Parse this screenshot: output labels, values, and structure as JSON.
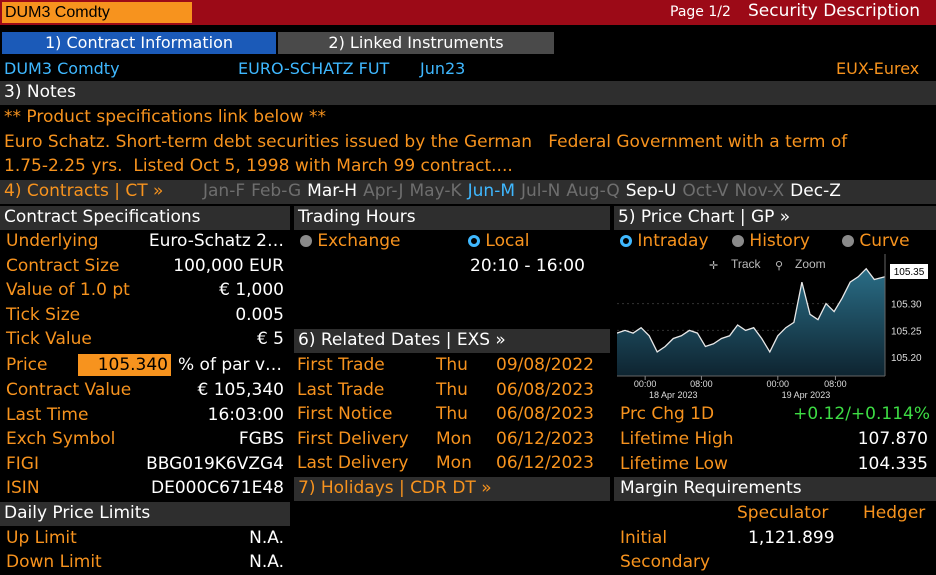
{
  "header": {
    "ticker": "DUM3 Comdty",
    "page": "Page 1/2",
    "title": "Security Description"
  },
  "tabs": [
    {
      "label": "1) Contract Information"
    },
    {
      "label": "2) Linked Instruments"
    }
  ],
  "security": {
    "ticker": "DUM3 Comdty",
    "name": "EURO-SCHATZ FUT",
    "month": "Jun23",
    "exchange": "EUX-Eurex"
  },
  "notes": {
    "title": "3) Notes",
    "link_line": "** Product specifications link below **",
    "desc1": "Euro Schatz. Short-term debt securities issued by the German   Federal Government with a term of",
    "desc2": "1.75-2.25 yrs.  Listed Oct 5, 1998 with March 99 contract...."
  },
  "contracts": {
    "label": "4) Contracts | CT »",
    "months": [
      "Jan-F",
      "Feb-G",
      "Mar-H",
      "Apr-J",
      "May-K",
      "Jun-M",
      "Jul-N",
      "Aug-Q",
      "Sep-U",
      "Oct-V",
      "Nov-X",
      "Dec-Z"
    ],
    "colors": [
      "#6e6e6e",
      "#6e6e6e",
      "#ffffff",
      "#6e6e6e",
      "#6e6e6e",
      "#3fb8ff",
      "#6e6e6e",
      "#6e6e6e",
      "#ffffff",
      "#6e6e6e",
      "#6e6e6e",
      "#ffffff"
    ]
  },
  "specs": {
    "title": "Contract Specifications",
    "rows": [
      {
        "label": "Underlying",
        "value": "Euro-Schatz 2…"
      },
      {
        "label": "Contract Size",
        "value": "100,000 EUR"
      },
      {
        "label": "Value of 1.0 pt",
        "value": "€ 1,000"
      },
      {
        "label": "Tick Size",
        "value": "0.005"
      },
      {
        "label": "Tick Value",
        "value": "€ 5"
      }
    ],
    "price_label": "Price",
    "price_value": "105.340",
    "price_unit": "% of par v…",
    "rows2": [
      {
        "label": "Contract Value",
        "value": "€ 105,340"
      },
      {
        "label": "Last Time",
        "value": "16:03:00"
      },
      {
        "label": "Exch Symbol",
        "value": "FGBS"
      },
      {
        "label": "FIGI",
        "value": "BBG019K6VZG4"
      },
      {
        "label": "ISIN",
        "value": "DE000C671E48"
      }
    ]
  },
  "limits": {
    "title": "Daily Price Limits",
    "up_label": "Up Limit",
    "up_value": "N.A.",
    "down_label": "Down Limit",
    "down_value": "N.A."
  },
  "hours": {
    "title": "Trading Hours",
    "exchange_label": "Exchange",
    "local_label": "Local",
    "time_range": "20:10 - 16:00"
  },
  "dates": {
    "title": "6) Related Dates | EXS »",
    "rows": [
      {
        "label": "First Trade",
        "day": "Thu",
        "date": "09/08/2022"
      },
      {
        "label": "Last Trade",
        "day": "Thu",
        "date": "06/08/2023"
      },
      {
        "label": "First Notice",
        "day": "Thu",
        "date": "06/08/2023"
      },
      {
        "label": "First Delivery",
        "day": "Mon",
        "date": "06/12/2023"
      },
      {
        "label": "Last Delivery",
        "day": "Mon",
        "date": "06/12/2023"
      }
    ],
    "holidays": "7) Holidays | CDR DT »"
  },
  "chart": {
    "title": "5) Price Chart | GP »",
    "modes": [
      "Intraday",
      "History",
      "Curve"
    ],
    "track_label": "Track",
    "zoom_label": "Zoom",
    "last_price_label": "105.35"
  },
  "chart_data": {
    "type": "area",
    "y_ticks": [
      "105.30",
      "105.25",
      "105.20"
    ],
    "ylim": [
      105.165,
      105.385
    ],
    "x_labels": [
      "00:00",
      "08:00",
      "00:00",
      "08:00"
    ],
    "date_labels": [
      "18 Apr 2023",
      "19 Apr 2023"
    ],
    "x": [
      0,
      0.03,
      0.06,
      0.09,
      0.12,
      0.15,
      0.18,
      0.21,
      0.24,
      0.27,
      0.3,
      0.33,
      0.36,
      0.39,
      0.42,
      0.45,
      0.48,
      0.51,
      0.54,
      0.57,
      0.6,
      0.63,
      0.66,
      0.69,
      0.72,
      0.75,
      0.78,
      0.81,
      0.84,
      0.87,
      0.9,
      0.93,
      0.96,
      1.0
    ],
    "values": [
      105.245,
      105.25,
      105.245,
      105.255,
      105.24,
      105.21,
      105.22,
      105.235,
      105.24,
      105.25,
      105.245,
      105.22,
      105.225,
      105.235,
      105.24,
      105.26,
      105.25,
      105.255,
      105.235,
      105.21,
      105.24,
      105.255,
      105.265,
      105.34,
      105.28,
      105.27,
      105.3,
      105.285,
      105.31,
      105.34,
      105.35,
      105.365,
      105.345,
      105.35
    ]
  },
  "performance": {
    "chg_label": "Prc Chg 1D",
    "chg_value": "+0.12/+0.114%",
    "high_label": "Lifetime High",
    "high_value": "107.870",
    "low_label": "Lifetime Low",
    "low_value": "104.335"
  },
  "margin": {
    "title": "Margin Requirements",
    "col1": "Speculator",
    "col2": "Hedger",
    "initial_label": "Initial",
    "initial_value": "1,121.899",
    "secondary_label": "Secondary"
  }
}
